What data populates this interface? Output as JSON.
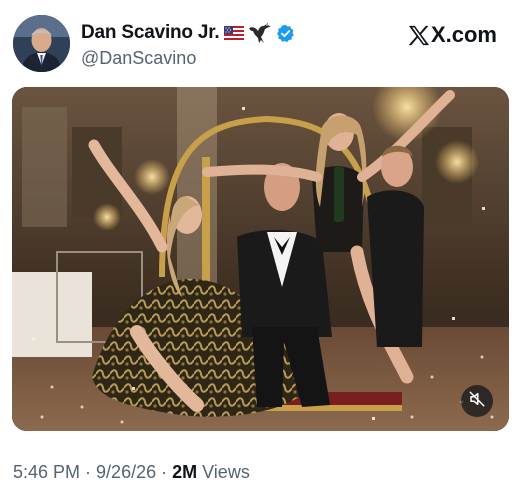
{
  "post": {
    "author": {
      "display_name": "Dan Scavino Jr.",
      "handle": "@DanScavino",
      "verified": true,
      "badges": [
        "us-flag-icon",
        "eagle-icon"
      ]
    },
    "site_brand": "X.com",
    "media": {
      "type": "photo",
      "mute_control": "mute-icon"
    },
    "time": "5:46 PM",
    "separator": "·",
    "date": "9/26/26",
    "views_count": "2M",
    "views_label": "Views"
  },
  "colors": {
    "text_primary": "#0f1419",
    "text_secondary": "#536471",
    "verified_blue": "#1d9bf0"
  }
}
